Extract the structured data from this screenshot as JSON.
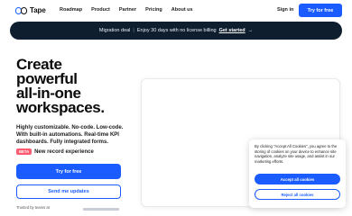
{
  "brand": {
    "name": "Tape",
    "logo_icon": "tape-logo-icon",
    "accent": "#1a5cff",
    "banner_bg": "#0f1e2e",
    "badge_color": "#ff5a6f"
  },
  "nav": {
    "links": [
      "Roadmap",
      "Product",
      "Partner",
      "Pricing",
      "About us"
    ],
    "signin": "Sign in",
    "try": "Try for free"
  },
  "banner": {
    "prefix": "Migration deal",
    "separator": "|",
    "text": "Enjoy 30 days with no license billing",
    "cta": "Get started",
    "arrow": "→"
  },
  "hero": {
    "headline": [
      "Create",
      "powerful",
      "all-in-one",
      "workspaces."
    ],
    "sub": "Highly customizable. No-code. Low-code. With built-in automations. Real-time KPI dashboards. Fully integrated forms.",
    "badge": "BETA",
    "new_text": "New record experience",
    "primary_button": "Try for free",
    "secondary_button": "Send me updates",
    "trusted": "Trusted by teams at"
  },
  "cookie": {
    "text": "By clicking \"Accept All Cookies\", you agree to the storing of cookies on your device to enhance site navigation, analyze site usage, and assist in our marketing efforts.",
    "accept": "Accept all cookies",
    "reject": "Reject all cookies"
  }
}
